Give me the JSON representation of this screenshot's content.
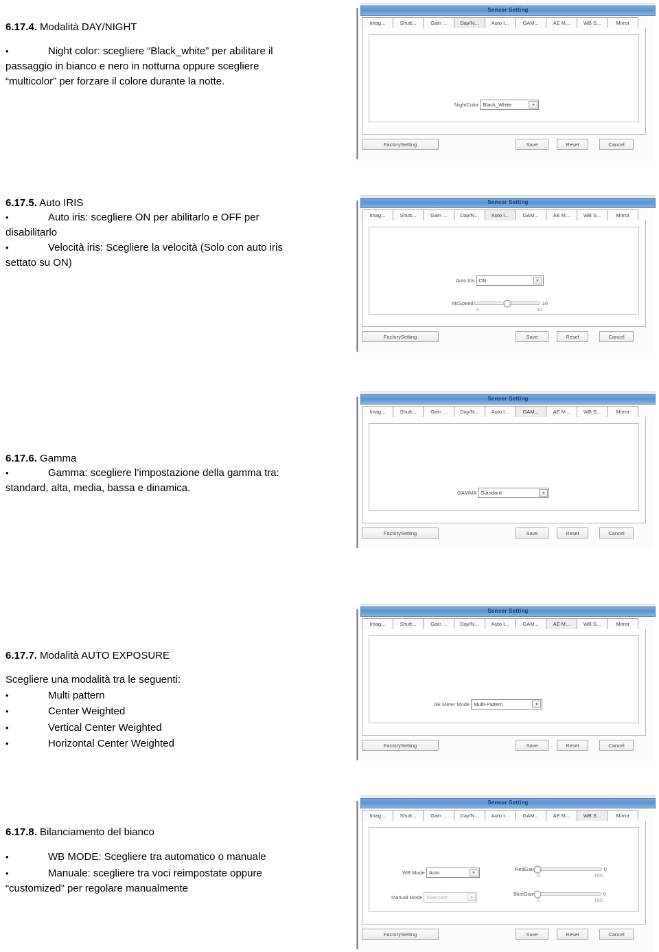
{
  "dialog": {
    "title": "Sensor Setting",
    "tabs": [
      "Imag...",
      "Shutt...",
      "Gain ...",
      "Day/N...",
      "Auto I...",
      "GAM...",
      "AE M...",
      "WB S...",
      "Mirror"
    ],
    "buttons": {
      "factory": "FactorySetting",
      "save": "Save",
      "reset": "Reset",
      "cancel": "Cancel"
    },
    "titlebar_color": "#5d93cf"
  },
  "sections": [
    {
      "number": "6.17.4.",
      "title": "Modalità DAY/NIGHT",
      "bullet1_a": "Night color: scegliere “Black_white” per abilitare il",
      "bullet1_b": "passaggio in bianco e nero in notturna oppure scegliere",
      "bullet1_c": "“multicolor” per forzare il colore durante la notte.",
      "panel": {
        "active_tab": "Day/N...",
        "field_label": "NightColor",
        "field_value": "Black_White"
      }
    },
    {
      "number": "6.17.5.",
      "title": "Auto IRIS",
      "bullet1_a": "Auto iris: scegliere ON per abilitarlo e OFF per",
      "bullet1_b": "disabilitarlo",
      "bullet2_a": "Velocità iris: Scegliere la velocità (Solo con auto iris",
      "bullet2_b": "settato su ON)",
      "panel": {
        "active_tab": "Auto I...",
        "field_label": "Auto Iris",
        "field_value": "ON",
        "slider_label": "IrisSpeed",
        "slider_value": "16",
        "slider_min": "0",
        "slider_max": "32"
      }
    },
    {
      "number": "6.17.6.",
      "title": "Gamma",
      "bullet1_a": "Gamma: scegliere l’impostazione della gamma tra:",
      "bullet1_b": "standard, alta, media, bassa e dinamica.",
      "panel": {
        "active_tab": "GAM...",
        "field_label": "GAMMA",
        "field_value": "Standard"
      }
    },
    {
      "number": "6.17.7.",
      "title": "Modalità AUTO EXPOSURE",
      "intro": "Scegliere una modalità tra le seguenti:",
      "items": [
        "Multi pattern",
        "Center Weighted",
        "Vertical Center Weighted",
        "Horizontal Center Weighted"
      ],
      "panel": {
        "active_tab": "AE M...",
        "field_label": "AE Meter Mode",
        "field_value": "Multi-Pattern"
      }
    },
    {
      "number": "6.17.8.",
      "title": "Bilanciamento del bianco",
      "bullet1": "WB MODE: Scegliere tra automatico o manuale",
      "bullet2_a": "Manuale: scegliere tra voci reimpostate oppure",
      "bullet2_b": "“customized” per regolare manualmente",
      "panel": {
        "active_tab": "WB S...",
        "wb_mode_label": "WB Mode",
        "wb_mode_value": "Auto",
        "manual_mode_label": "Manual Mode",
        "manual_mode_value": "Overcast",
        "red_gain_label": "RedGain",
        "red_gain_value": "0",
        "red_gain_min": "0",
        "red_gain_max": "100",
        "blue_gain_label": "BlueGain",
        "blue_gain_value": "0",
        "blue_gain_min": "0",
        "blue_gain_max": "100"
      }
    }
  ]
}
